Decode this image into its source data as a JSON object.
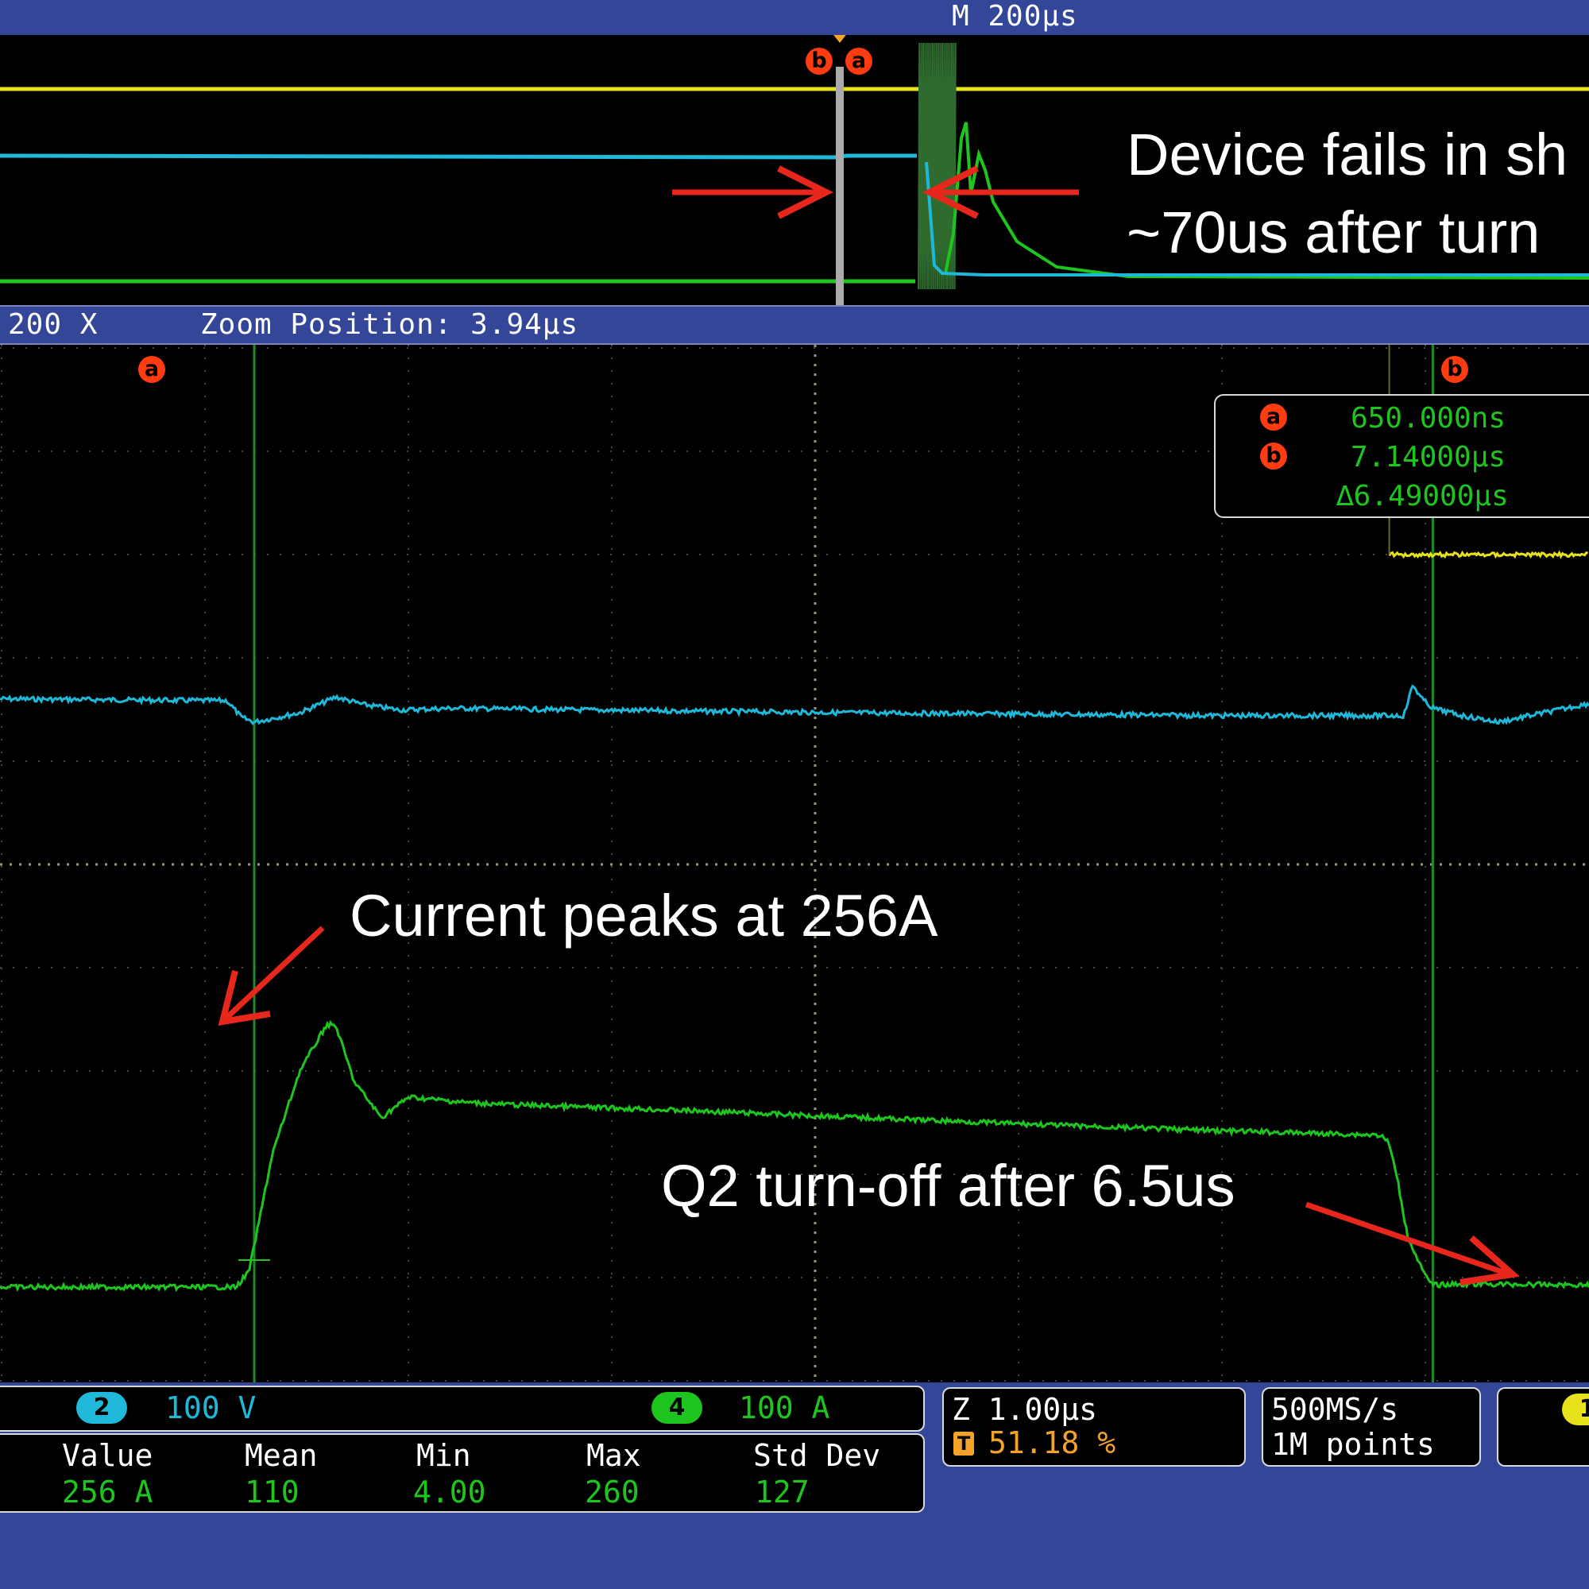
{
  "colors": {
    "bezel": "#344698",
    "ch1_yellow": "#e8e21c",
    "ch2_cyan": "#1fb8d8",
    "ch4_green": "#1fc51f",
    "cursor": "#ff3b12",
    "annotation_arrow": "#e8271c",
    "trigger_orange": "#f2a32a"
  },
  "overview": {
    "timebase_label": "M 200µs",
    "cursor_tags": [
      "b",
      "a"
    ],
    "annotation_line1": "Device fails in sh",
    "annotation_line2": "~70us after turn"
  },
  "zoom_bar": {
    "zoom_factor": "200 X",
    "zoom_position": "Zoom Position: 3.94µs"
  },
  "zoom_view": {
    "cursor_a_tag": "a",
    "cursor_b_tag": "b",
    "readout": {
      "a_label": "a",
      "a_value": "650.000ns",
      "b_label": "b",
      "b_value": "7.14000µs",
      "delta_value": "∆6.49000µs"
    },
    "annotations": {
      "current_peak": "Current peaks at 256A",
      "turn_off": "Q2 turn-off after 6.5us"
    }
  },
  "channels": {
    "ch2_number": "2",
    "ch2_scale": "100 V",
    "ch4_number": "4",
    "ch4_scale": "100 A",
    "ch1_number": "1"
  },
  "measurements": {
    "headers": [
      "Value",
      "Mean",
      "Min",
      "Max",
      "Std Dev"
    ],
    "values": [
      "256 A",
      "110",
      "4.00",
      "260",
      "127"
    ]
  },
  "horizontal": {
    "zoom_scale": "Z 1.00µs",
    "trigger_icon": "T",
    "trigger_position": "51.18 %"
  },
  "acquisition": {
    "sample_rate": "500MS/s",
    "record_length": "1M points"
  },
  "chart_data": {
    "type": "line",
    "title": "",
    "xlabel": "",
    "ylabel": "",
    "xlim_us": [
      -0.75,
      8.0
    ],
    "cursors_us": {
      "a": 0.65,
      "b": 7.14,
      "delta": 6.49
    },
    "series": [
      {
        "name": "",
        "channel": 4,
        "unit": "A",
        "scale_per_div": 100,
        "x_us": [
          -0.75,
          0.55,
          0.62,
          0.65,
          0.75,
          0.9,
          1.05,
          1.1,
          1.2,
          1.35,
          1.5,
          1.8,
          2.0,
          3.0,
          4.0,
          5.0,
          6.0,
          6.85,
          6.9,
          6.95,
          7.0,
          7.1,
          7.14,
          7.3,
          8.0
        ],
        "values": [
          0,
          0,
          15,
          40,
          130,
          210,
          256,
          254,
          200,
          165,
          185,
          180,
          178,
          172,
          165,
          158,
          152,
          148,
          140,
          100,
          50,
          10,
          2,
          3,
          2
        ]
      },
      {
        "name": "",
        "channel": 2,
        "unit": "V",
        "scale_per_div": 100,
        "x_us": [
          -0.75,
          0.5,
          0.58,
          0.65,
          0.9,
          1.1,
          1.25,
          1.45,
          1.75,
          2.5,
          4.0,
          6.0,
          6.98,
          7.03,
          7.08,
          7.14,
          7.3,
          7.5,
          8.0
        ],
        "values": [
          30,
          28,
          10,
          5,
          15,
          32,
          24,
          18,
          20,
          18,
          15,
          12,
          12,
          45,
          30,
          20,
          12,
          5,
          25
        ]
      },
      {
        "name": "",
        "channel": 1,
        "unit": "",
        "x_us": [
          6.9,
          7.2,
          7.6,
          8.0
        ],
        "values": [
          0,
          0,
          0,
          0
        ]
      }
    ]
  }
}
